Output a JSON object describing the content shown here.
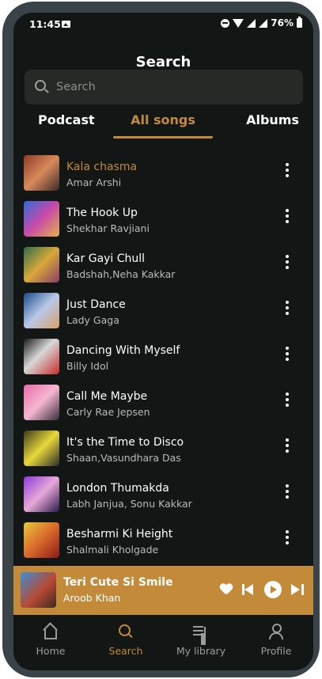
{
  "status_bar": {
    "time": "11:45",
    "battery": "76%"
  },
  "header": {
    "title": "Search"
  },
  "search": {
    "placeholder": "Search",
    "value": ""
  },
  "tabs": [
    {
      "label": "Podcast",
      "active": false
    },
    {
      "label": "All songs",
      "active": true
    },
    {
      "label": "Albums",
      "active": false
    }
  ],
  "songs": [
    {
      "title": "Kala chasma",
      "artist": "Amar Arshi",
      "active": true
    },
    {
      "title": "The Hook Up",
      "artist": "Shekhar Ravjiani",
      "active": false
    },
    {
      "title": "Kar Gayi Chull",
      "artist": "Badshah,Neha Kakkar",
      "active": false
    },
    {
      "title": "Just Dance",
      "artist": "Lady Gaga",
      "active": false
    },
    {
      "title": "Dancing With Myself",
      "artist": "Billy Idol",
      "active": false
    },
    {
      "title": "Call Me Maybe",
      "artist": "Carly Rae Jepsen",
      "active": false
    },
    {
      "title": "It's the Time to Disco",
      "artist": "Shaan,Vasundhara Das",
      "active": false
    },
    {
      "title": "London Thumakda",
      "artist": "Labh Janjua, Sonu Kakkar",
      "active": false
    },
    {
      "title": "Besharmi Ki Height",
      "artist": "Shalmali Kholgade",
      "active": false
    }
  ],
  "now_playing": {
    "title": "Teri Cute Si Smile",
    "artist": "Aroob Khan"
  },
  "bottom_nav": [
    {
      "label": "Home",
      "icon": "home-icon",
      "active": false
    },
    {
      "label": "Search",
      "icon": "search-icon",
      "active": true
    },
    {
      "label": "My library",
      "icon": "library-icon",
      "active": false
    },
    {
      "label": "Profile",
      "icon": "profile-icon",
      "active": false
    }
  ],
  "colors": {
    "accent": "#c38a3a",
    "background": "#121614",
    "surface": "#262a27"
  }
}
